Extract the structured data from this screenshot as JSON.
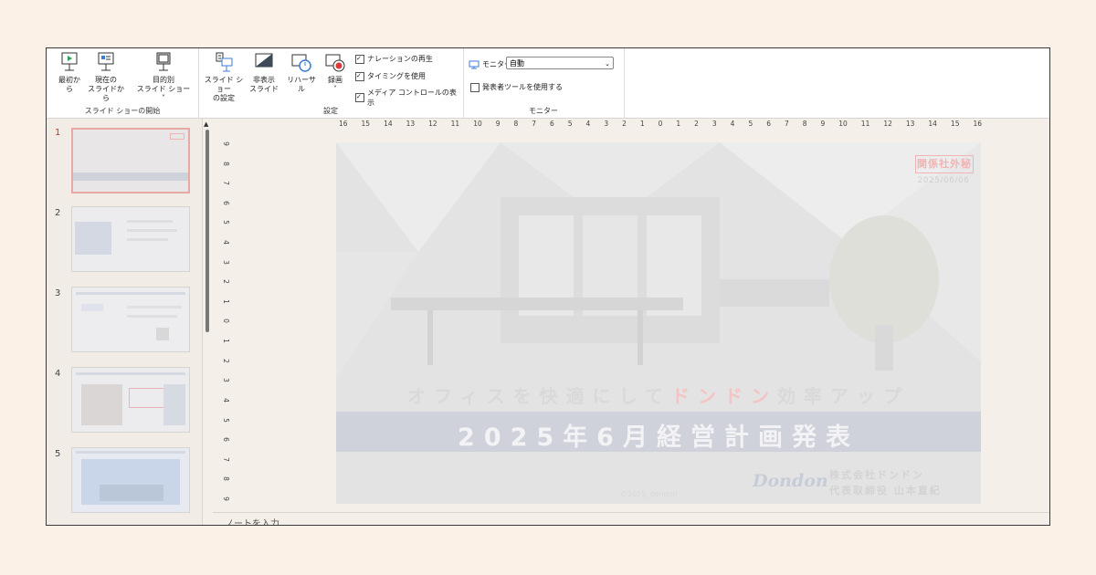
{
  "ribbon": {
    "start_group": {
      "label": "スライド ショーの開始",
      "from_beginning": "最初から",
      "from_current_l1": "現在の",
      "from_current_l2": "スライドから",
      "custom_l1": "目的別",
      "custom_l2": "スライド ショー ˅"
    },
    "setup_group": {
      "label": "設定",
      "setup_show_l1": "スライド ショー",
      "setup_show_l2": "の設定",
      "hide_slide_l1": "非表示",
      "hide_slide_l2": "スライド",
      "rehearse": "リハーサル",
      "record": "録画",
      "record_caret": "˅",
      "narration": "ナレーションの再生",
      "timings": "タイミングを使用",
      "media_controls": "メディア コントロールの表示"
    },
    "monitor_group": {
      "label": "モニター",
      "monitor_label": "モニター:",
      "monitor_value": "自動",
      "presenter_view": "発表者ツールを使用する"
    }
  },
  "checkboxes": {
    "narration": true,
    "timings": true,
    "media_controls": true,
    "presenter_view": false
  },
  "thumbnails": [
    {
      "num": "1",
      "selected": true
    },
    {
      "num": "2",
      "selected": false
    },
    {
      "num": "3",
      "selected": false
    },
    {
      "num": "4",
      "selected": false
    },
    {
      "num": "5",
      "selected": false
    }
  ],
  "hruler": [
    "16",
    "15",
    "14",
    "13",
    "12",
    "11",
    "10",
    "9",
    "8",
    "7",
    "6",
    "5",
    "4",
    "3",
    "2",
    "1",
    "0",
    "1",
    "2",
    "3",
    "4",
    "5",
    "6",
    "7",
    "8",
    "9",
    "10",
    "11",
    "12",
    "13",
    "14",
    "15",
    "16"
  ],
  "vruler": [
    "9",
    "8",
    "7",
    "6",
    "5",
    "4",
    "3",
    "2",
    "1",
    "0",
    "1",
    "2",
    "3",
    "4",
    "5",
    "6",
    "7",
    "8",
    "9"
  ],
  "slide": {
    "stamp": "関係社外秘",
    "date": "2025/06/06",
    "subtitle_pre": "オフィスを快適にして",
    "subtitle_highlight": "ドンドン",
    "subtitle_post": "効率アップ",
    "title": "2025年6月経営計画発表",
    "copyright": "©2025_dondon",
    "logo": "Dondon",
    "company_l1": "株式会社ドンドン",
    "company_l2": "代表取締役 山本直紀"
  },
  "notes": {
    "placeholder": "ノートを入力"
  },
  "colors": {
    "page_bg": "#fcf1e6",
    "accent_pink": "#f4c3c3",
    "selected_thumb_border": "#e6a9a3"
  }
}
